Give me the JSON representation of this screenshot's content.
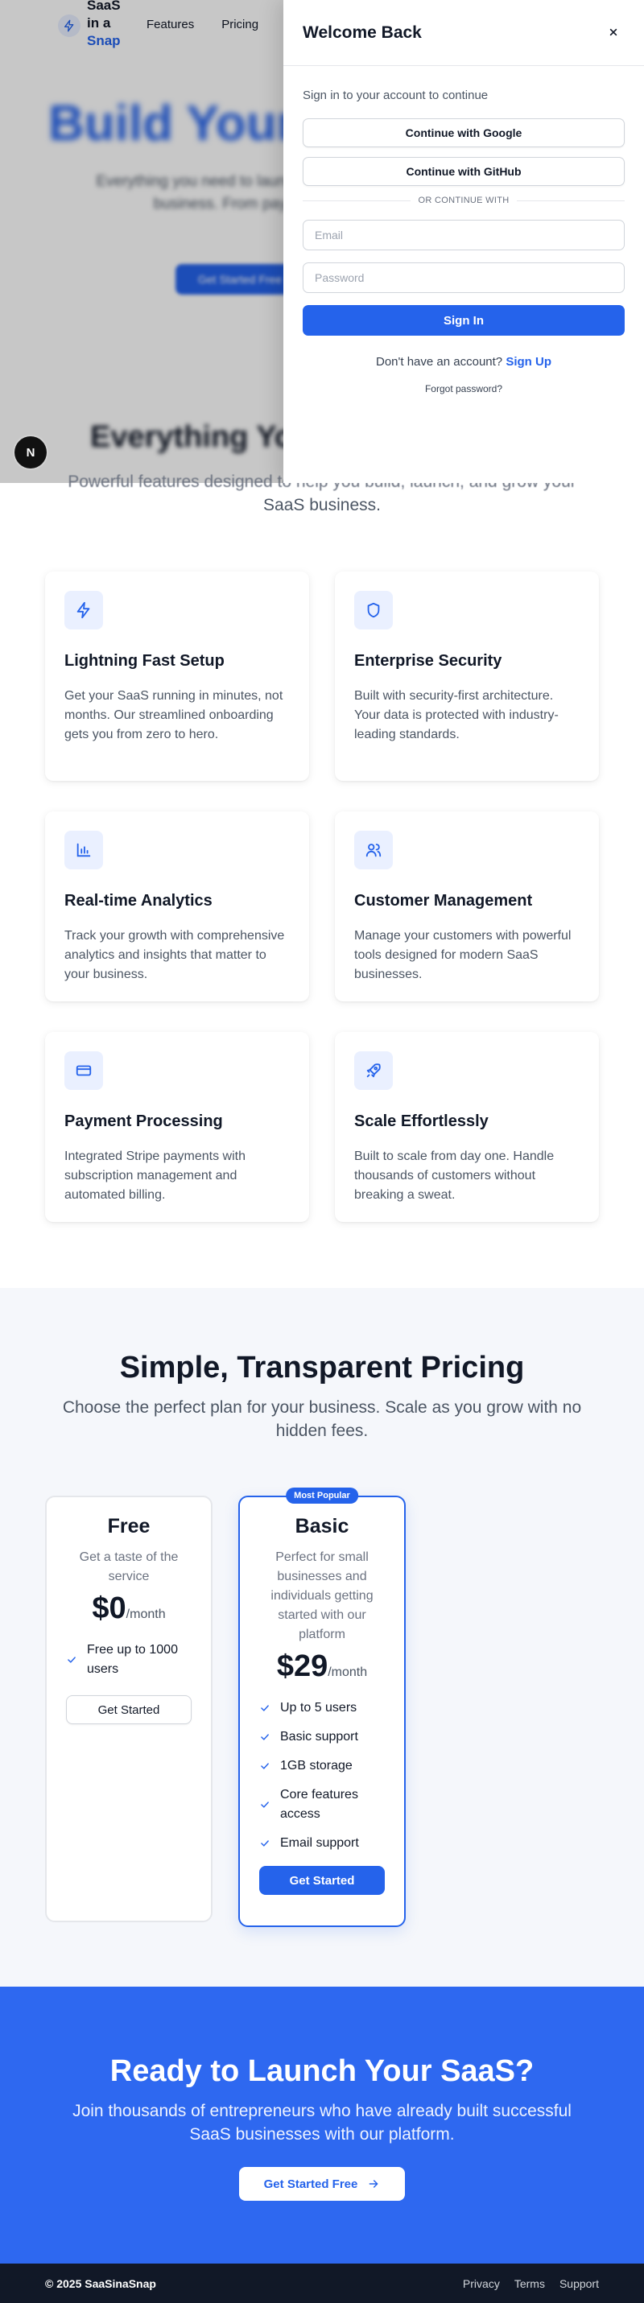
{
  "nav": {
    "logo_line1": "SaaS",
    "logo_line2": "in a",
    "logo_line3": "Snap",
    "links": [
      "Features",
      "Pricing"
    ]
  },
  "hero": {
    "title": "Build Your",
    "subtitle": "Everything you need to launch and grow your business. From payments to",
    "cta_label": "Get Started Free"
  },
  "modal": {
    "title": "Welcome Back",
    "description": "Sign in to your account to continue",
    "google_label": "Continue with Google",
    "github_label": "Continue with GitHub",
    "divider_text": "OR CONTINUE WITH",
    "email_placeholder": "Email",
    "password_placeholder": "Password",
    "signin_label": "Sign In",
    "no_account_text": "Don't have an account?",
    "signup_link": "Sign Up",
    "forgot_link": "Forgot password?"
  },
  "next_badge": "N",
  "features": {
    "heading": "Everything Yo",
    "subtitle_line1": "Powerful features designed to help you build, launch, and grow your",
    "subtitle_line2": "SaaS business.",
    "cards": [
      {
        "icon": "lightning-icon",
        "title": "Lightning Fast Setup",
        "desc": "Get your SaaS running in minutes, not months. Our streamlined onboarding gets you from zero to hero."
      },
      {
        "icon": "shield-icon",
        "title": "Enterprise Security",
        "desc": "Built with security-first architecture. Your data is protected with industry-leading standards."
      },
      {
        "icon": "bar-chart-icon",
        "title": "Real-time Analytics",
        "desc": "Track your growth with comprehensive analytics and insights that matter to your business."
      },
      {
        "icon": "users-icon",
        "title": "Customer Management",
        "desc": "Manage your customers with powerful tools designed for modern SaaS businesses."
      },
      {
        "icon": "credit-card-icon",
        "title": "Payment Processing",
        "desc": "Integrated Stripe payments with subscription management and automated billing."
      },
      {
        "icon": "rocket-icon",
        "title": "Scale Effortlessly",
        "desc": "Built to scale from day one. Handle thousands of customers without breaking a sweat."
      }
    ]
  },
  "pricing": {
    "title": "Simple, Transparent Pricing",
    "subtitle": "Choose the perfect plan for your business. Scale as you grow with no hidden fees.",
    "plans": [
      {
        "name": "Free",
        "desc": "Get a taste of the service",
        "price": "$0",
        "period": "/month",
        "features": [
          "Free up to 1000 users"
        ],
        "button": "Get Started",
        "popular": false
      },
      {
        "name": "Basic",
        "badge": "Most Popular",
        "desc": "Perfect for small businesses and individuals getting started with our platform",
        "price": "$29",
        "period": "/month",
        "features": [
          "Up to 5 users",
          "Basic support",
          "1GB storage",
          "Core features access",
          "Email support"
        ],
        "button": "Get Started",
        "popular": true
      }
    ]
  },
  "cta": {
    "title": "Ready to Launch Your SaaS?",
    "subtitle": "Join thousands of entrepreneurs who have already built successful SaaS businesses with our platform.",
    "button": "Get Started Free"
  },
  "footer": {
    "copyright": "© 2025 SaaSinaSnap",
    "links": [
      "Privacy",
      "Terms",
      "Support"
    ]
  },
  "colors": {
    "primary": "#2563eb",
    "cta_bg": "#2e68f0",
    "footer_bg": "#111827",
    "pricing_bg": "#f5f7fb"
  }
}
